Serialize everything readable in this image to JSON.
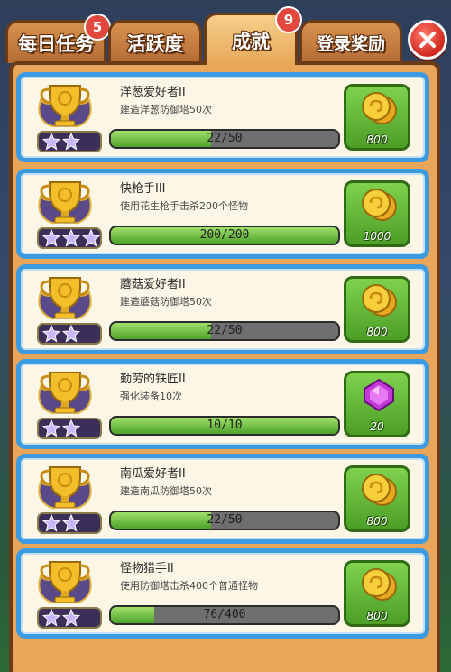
{
  "tabs": [
    {
      "label": "每日任务",
      "badge": "5",
      "active": false
    },
    {
      "label": "活跃度",
      "badge": "",
      "active": false
    },
    {
      "label": "成就",
      "badge": "9",
      "active": true
    },
    {
      "label": "登录奖励",
      "badge": "",
      "active": false
    }
  ],
  "achievements": [
    {
      "title": "洋葱爱好者II",
      "desc": "建造洋葱防御塔50次",
      "stars": 2,
      "progress_text": "22/50",
      "progress": 0.44,
      "reward_type": "coin-icon",
      "reward_amount": "800"
    },
    {
      "title": "快枪手III",
      "desc": "使用花生枪手击杀200个怪物",
      "stars": 3,
      "progress_text": "200/200",
      "progress": 1.0,
      "reward_type": "coin-icon",
      "reward_amount": "1000"
    },
    {
      "title": "蘑菇爱好者II",
      "desc": "建造蘑菇防御塔50次",
      "stars": 2,
      "progress_text": "22/50",
      "progress": 0.44,
      "reward_type": "coin-icon",
      "reward_amount": "800"
    },
    {
      "title": "勤劳的铁匠II",
      "desc": "强化装备10次",
      "stars": 2,
      "progress_text": "10/10",
      "progress": 1.0,
      "reward_type": "gem-icon",
      "reward_amount": "20"
    },
    {
      "title": "南瓜爱好者II",
      "desc": "建造南瓜防御塔50次",
      "stars": 2,
      "progress_text": "22/50",
      "progress": 0.44,
      "reward_type": "coin-icon",
      "reward_amount": "800"
    },
    {
      "title": "怪物猎手II",
      "desc": "使用防御塔击杀400个普通怪物",
      "stars": 2,
      "progress_text": "76/400",
      "progress": 0.19,
      "reward_type": "coin-icon",
      "reward_amount": "800"
    }
  ],
  "colors": {
    "card_border": "#3c9be0",
    "progress_fill": "#6cc23a",
    "reward_bg": "#63b637",
    "tab": "#c97c3e"
  }
}
